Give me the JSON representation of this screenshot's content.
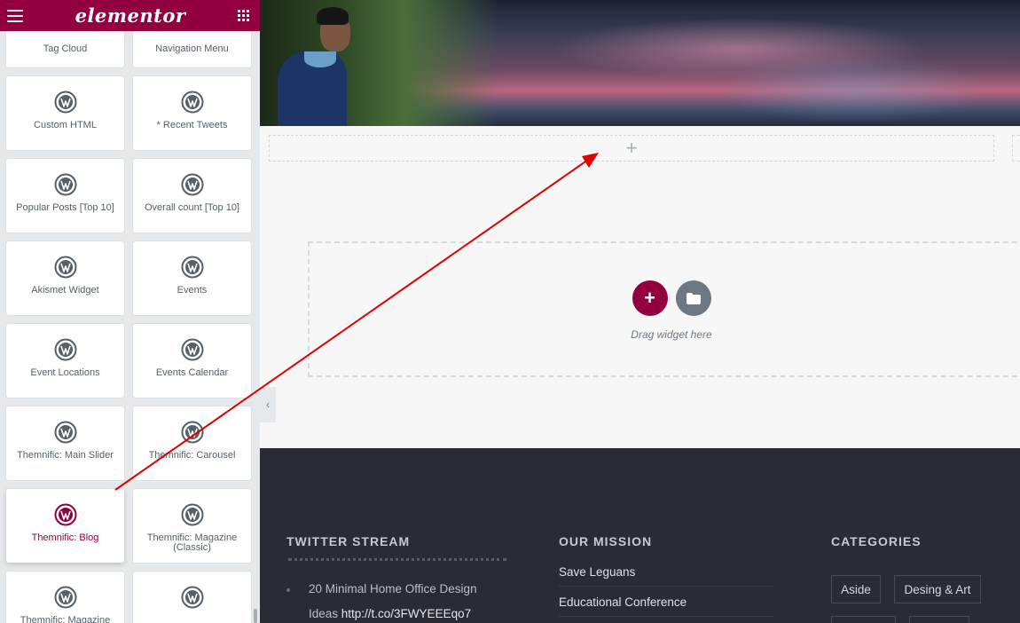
{
  "panel": {
    "logo": "elementor",
    "widgets": [
      {
        "label": "Tag Cloud"
      },
      {
        "label": "Navigation Menu"
      },
      {
        "label": "Custom HTML"
      },
      {
        "label": "* Recent Tweets"
      },
      {
        "label": "Popular Posts [Top 10]"
      },
      {
        "label": "Overall count [Top 10]"
      },
      {
        "label": "Akismet Widget"
      },
      {
        "label": "Events"
      },
      {
        "label": "Event Locations"
      },
      {
        "label": "Events Calendar"
      },
      {
        "label": "Themnific: Main Slider"
      },
      {
        "label": "Themnific: Carousel"
      },
      {
        "label": "Themnific: Blog"
      },
      {
        "label": "Themnific: Magazine (Classic)"
      },
      {
        "label": "Themnific: Magazine (Plain"
      },
      {
        "label": ""
      }
    ]
  },
  "canvas": {
    "drop_zone_text": "Drag widget here"
  },
  "footer": {
    "twitter": {
      "title": "TWITTER STREAM",
      "tweet_line1": "20 Minimal Home Office Design",
      "tweet_line2_prefix": "Ideas ",
      "tweet_link": "http://t.co/3FWYEEEqo7"
    },
    "mission": {
      "title": "OUR MISSION",
      "items": [
        "Save Leguans",
        "Educational Conference"
      ]
    },
    "categories": {
      "title": "CATEGORIES",
      "tags": [
        "Aside",
        "Desing & Art"
      ]
    }
  },
  "colors": {
    "brand": "#93003f",
    "panel_bg": "#e6e9ec",
    "footer_bg": "#2b2b33",
    "arrow": "#e00000"
  },
  "icons": {
    "widget_icon": "wordpress-icon",
    "menu": "hamburger-icon",
    "apps": "grid-icon",
    "add": "plus-icon",
    "template": "folder-icon",
    "collapse": "chevron-left-icon"
  }
}
